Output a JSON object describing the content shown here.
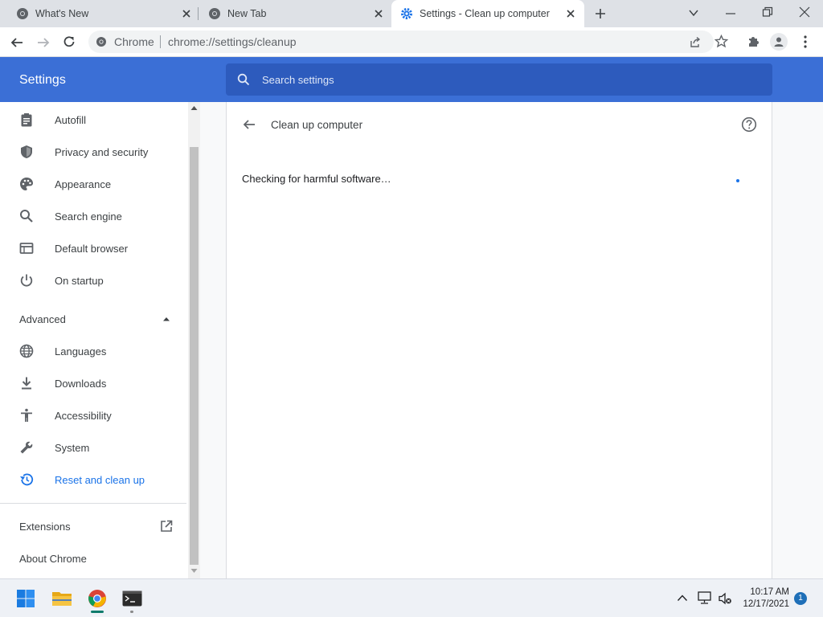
{
  "browser": {
    "tabs": [
      {
        "title": "What's New",
        "active": false
      },
      {
        "title": "New Tab",
        "active": false
      },
      {
        "title": "Settings - Clean up computer",
        "active": true
      }
    ],
    "omnibox": {
      "site_label": "Chrome",
      "url": "chrome://settings/cleanup"
    }
  },
  "settings": {
    "header_title": "Settings",
    "search_placeholder": "Search settings",
    "sidebar": {
      "items": [
        {
          "label": "Autofill",
          "icon": "clipboard-icon"
        },
        {
          "label": "Privacy and security",
          "icon": "shield-icon"
        },
        {
          "label": "Appearance",
          "icon": "palette-icon"
        },
        {
          "label": "Search engine",
          "icon": "search-icon"
        },
        {
          "label": "Default browser",
          "icon": "browser-window-icon"
        },
        {
          "label": "On startup",
          "icon": "power-icon"
        }
      ],
      "advanced_label": "Advanced",
      "advanced_items": [
        {
          "label": "Languages",
          "icon": "globe-icon"
        },
        {
          "label": "Downloads",
          "icon": "download-icon"
        },
        {
          "label": "Accessibility",
          "icon": "accessibility-icon"
        },
        {
          "label": "System",
          "icon": "wrench-icon"
        },
        {
          "label": "Reset and clean up",
          "icon": "history-icon",
          "active": true
        }
      ],
      "extensions_label": "Extensions",
      "about_label": "About Chrome"
    },
    "page": {
      "title": "Clean up computer",
      "status_text": "Checking for harmful software…"
    }
  },
  "taskbar": {
    "time": "10:17 AM",
    "date": "12/17/2021",
    "notification_count": "1"
  },
  "colors": {
    "header_blue": "#3b6fd6",
    "active_link": "#1a73e8"
  }
}
